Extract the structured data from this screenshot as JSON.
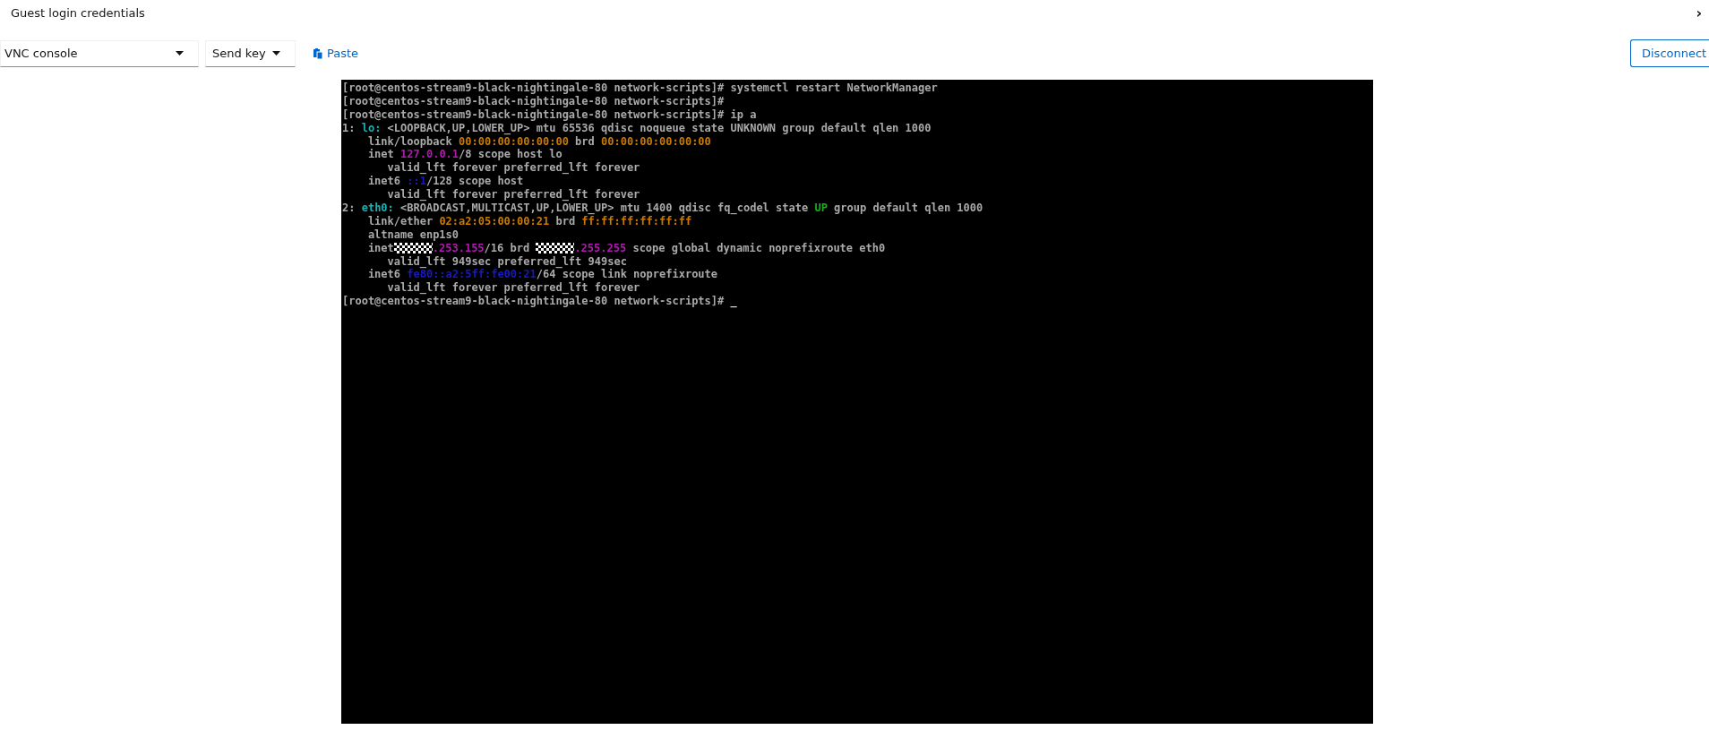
{
  "header": {
    "title": "Guest login credentials",
    "toggle": "›"
  },
  "toolbar": {
    "console_select": "VNC console",
    "send_key": "Send key",
    "paste": "Paste",
    "disconnect": "Disconnect"
  },
  "console": {
    "lines": [
      [
        {
          "kind": "text",
          "text": "[root@centos-stream9-black-nightingale-80 network-scripts]# systemctl restart NetworkManager",
          "color": "#aaaaaa"
        }
      ],
      [
        {
          "kind": "text",
          "text": "[root@centos-stream9-black-nightingale-80 network-scripts]#",
          "color": "#aaaaaa"
        }
      ],
      [
        {
          "kind": "text",
          "text": "[root@centos-stream9-black-nightingale-80 network-scripts]# ip a",
          "color": "#aaaaaa"
        }
      ],
      [
        {
          "kind": "text",
          "text": "1: ",
          "color": "#aaaaaa"
        },
        {
          "kind": "text",
          "text": "lo:",
          "color": "#18b2b2"
        },
        {
          "kind": "text",
          "text": " <LOOPBACK,UP,LOWER_UP> mtu 65536 qdisc noqueue state UNKNOWN group default qlen 1000",
          "color": "#aaaaaa"
        }
      ],
      [
        {
          "kind": "text",
          "text": "    link/loopback ",
          "color": "#aaaaaa"
        },
        {
          "kind": "text",
          "text": "00:00:00:00:00:00",
          "color": "#c87a00"
        },
        {
          "kind": "text",
          "text": " brd ",
          "color": "#aaaaaa"
        },
        {
          "kind": "text",
          "text": "00:00:00:00:00:00",
          "color": "#c87a00"
        }
      ],
      [
        {
          "kind": "text",
          "text": "    inet ",
          "color": "#aaaaaa"
        },
        {
          "kind": "text",
          "text": "127.0.0.1",
          "color": "#b218b2"
        },
        {
          "kind": "text",
          "text": "/8 scope host lo",
          "color": "#aaaaaa"
        }
      ],
      [
        {
          "kind": "text",
          "text": "       valid_lft forever preferred_lft forever",
          "color": "#aaaaaa"
        }
      ],
      [
        {
          "kind": "text",
          "text": "    inet6 ",
          "color": "#aaaaaa"
        },
        {
          "kind": "text",
          "text": "::1",
          "color": "#1818c8"
        },
        {
          "kind": "text",
          "text": "/128 scope host",
          "color": "#aaaaaa"
        }
      ],
      [
        {
          "kind": "text",
          "text": "       valid_lft forever preferred_lft forever",
          "color": "#aaaaaa"
        }
      ],
      [
        {
          "kind": "text",
          "text": "2: ",
          "color": "#aaaaaa"
        },
        {
          "kind": "text",
          "text": "eth0:",
          "color": "#18b2b2"
        },
        {
          "kind": "text",
          "text": " <BROADCAST,MULTICAST,UP,LOWER_UP> mtu 1400 qdisc fq_codel state ",
          "color": "#aaaaaa"
        },
        {
          "kind": "text",
          "text": "UP",
          "color": "#18b218"
        },
        {
          "kind": "text",
          "text": " group default qlen 1000",
          "color": "#aaaaaa"
        }
      ],
      [
        {
          "kind": "text",
          "text": "    link/ether ",
          "color": "#aaaaaa"
        },
        {
          "kind": "text",
          "text": "02:a2:05:00:00:21",
          "color": "#c87a00"
        },
        {
          "kind": "text",
          "text": " brd ",
          "color": "#aaaaaa"
        },
        {
          "kind": "text",
          "text": "ff:ff:ff:ff:ff:ff",
          "color": "#c87a00"
        }
      ],
      [
        {
          "kind": "text",
          "text": "    altname enp1s0",
          "color": "#aaaaaa"
        }
      ],
      [
        {
          "kind": "text",
          "text": "    inet",
          "color": "#aaaaaa"
        },
        {
          "kind": "redacted"
        },
        {
          "kind": "text",
          "text": ".253.155",
          "color": "#b218b2"
        },
        {
          "kind": "text",
          "text": "/16 brd ",
          "color": "#aaaaaa"
        },
        {
          "kind": "redacted"
        },
        {
          "kind": "text",
          "text": ".255.255",
          "color": "#b218b2"
        },
        {
          "kind": "text",
          "text": " scope global dynamic noprefixroute eth0",
          "color": "#aaaaaa"
        }
      ],
      [
        {
          "kind": "text",
          "text": "       valid_lft 949sec preferred_lft 949sec",
          "color": "#aaaaaa"
        }
      ],
      [
        {
          "kind": "text",
          "text": "    inet6 ",
          "color": "#aaaaaa"
        },
        {
          "kind": "text",
          "text": "fe80::a2:5ff:fe00:21",
          "color": "#1818c8"
        },
        {
          "kind": "text",
          "text": "/64 scope link noprefixroute",
          "color": "#aaaaaa"
        }
      ],
      [
        {
          "kind": "text",
          "text": "       valid_lft forever preferred_lft forever",
          "color": "#aaaaaa"
        }
      ],
      [
        {
          "kind": "text",
          "text": "[root@centos-stream9-black-nightingale-80 network-scripts]# ",
          "color": "#aaaaaa"
        },
        {
          "kind": "text",
          "text": "_",
          "color": "#dddddd"
        }
      ]
    ]
  }
}
